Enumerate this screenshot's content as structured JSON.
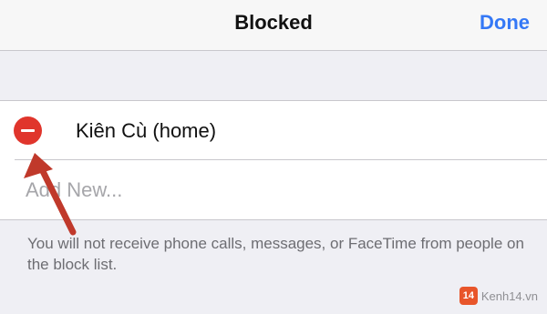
{
  "navbar": {
    "title": "Blocked",
    "done_label": "Done"
  },
  "blocked_list": {
    "contacts": [
      {
        "name": "Kiên Cù (home)"
      }
    ],
    "add_new_label": "Add New..."
  },
  "footer_note": "You will not receive phone calls, messages, or FaceTime from people on the block list.",
  "annotation": {
    "arrow_color": "#c0392b"
  },
  "watermark": {
    "logo_text": "14",
    "site": "Kenh14.vn"
  },
  "colors": {
    "accent": "#3478f6",
    "delete": "#e0352c",
    "background": "#efeff4"
  }
}
